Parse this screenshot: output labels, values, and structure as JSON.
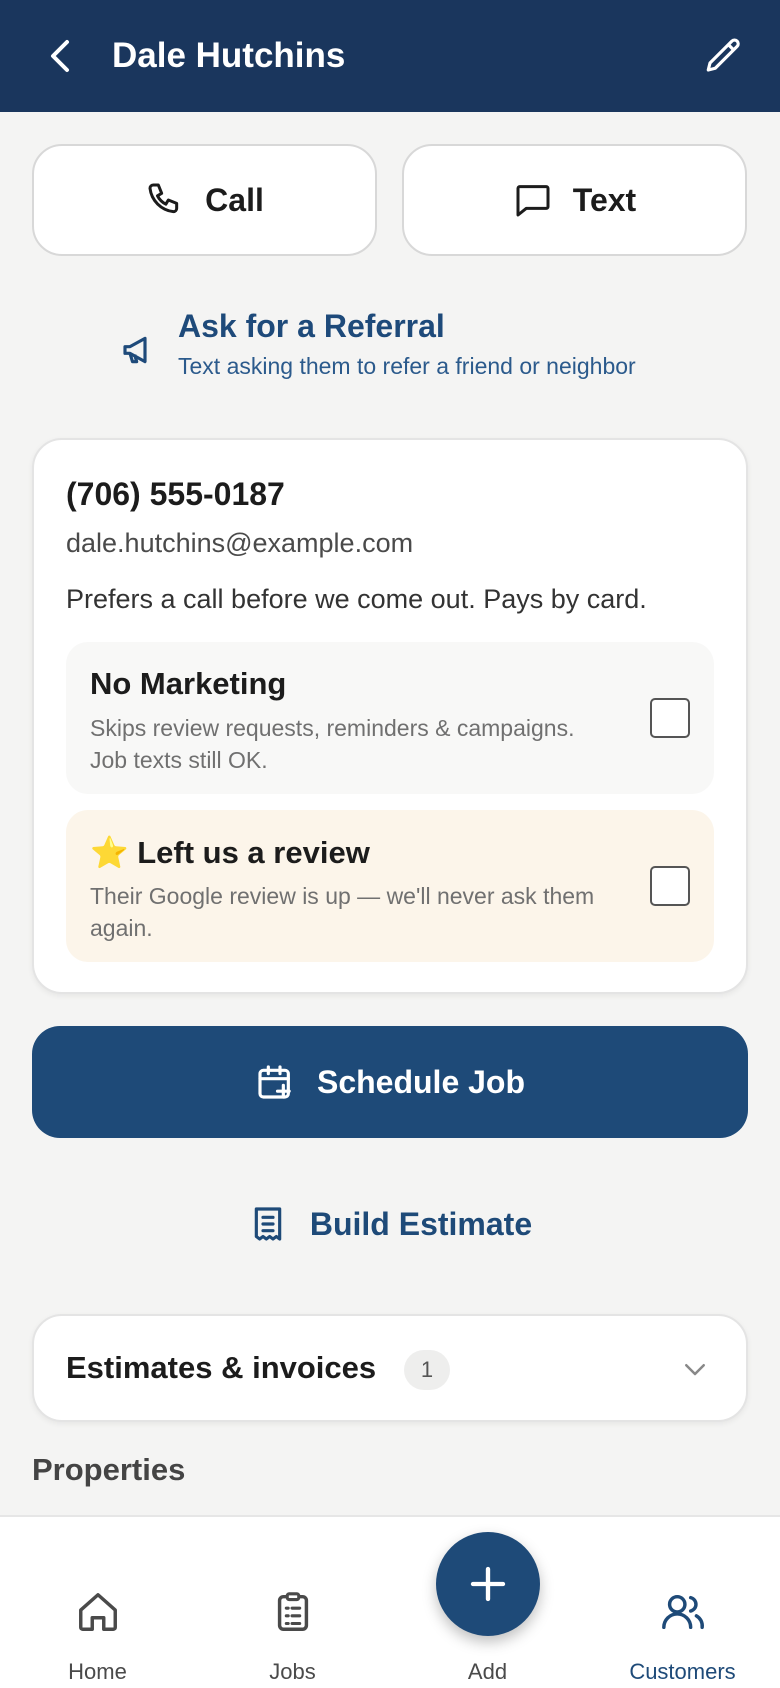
{
  "header": {
    "title": "Dale Hutchins",
    "back_icon": "chevron-left-icon",
    "edit_icon": "pencil-icon",
    "color": "#1a365d"
  },
  "actions": {
    "call_label": "Call",
    "text_label": "Text"
  },
  "referral": {
    "title": "Ask for a Referral",
    "subtitle": "Text asking them to refer a friend or neighbor",
    "icon": "megaphone-icon"
  },
  "contact": {
    "phone": "(706) 555-0187",
    "email": "dale.hutchins@example.com",
    "note": "Prefers a call before we come out. Pays by card."
  },
  "options": {
    "no_marketing": {
      "title": "No Marketing",
      "description": "Skips review requests, reminders & campaigns. Job texts still OK.",
      "checked": false
    },
    "left_review": {
      "title": "⭐ Left us a review",
      "description": "Their Google review is up — we'll never ask them again.",
      "checked": false
    }
  },
  "primary_action": {
    "label": "Schedule Job",
    "icon": "calendar-plus-icon"
  },
  "secondary_action": {
    "label": "Build Estimate",
    "icon": "receipt-icon"
  },
  "accordion": {
    "title": "Estimates & invoices",
    "count": "1"
  },
  "properties": {
    "title": "Properties"
  },
  "tabbar": {
    "items": [
      {
        "label": "Home",
        "icon": "home-icon"
      },
      {
        "label": "Jobs",
        "icon": "clipboard-list-icon"
      },
      {
        "label": "Add",
        "icon": "plus-icon"
      },
      {
        "label": "Customers",
        "icon": "users-icon",
        "active": true
      }
    ]
  },
  "colors": {
    "accent": "#1e4a78",
    "review_bg": "#fcf5ea"
  }
}
